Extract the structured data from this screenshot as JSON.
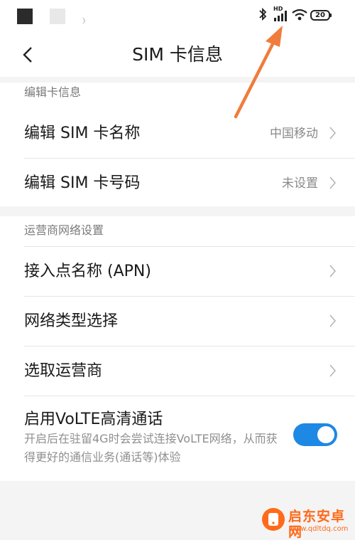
{
  "status_bar": {
    "signal_badge": "HD",
    "battery_level": "20",
    "icons": [
      "bluetooth-icon",
      "signal-icon",
      "wifi-icon",
      "battery-icon"
    ]
  },
  "header": {
    "title": "SIM  卡信息",
    "back_icon": "chevron-left-icon"
  },
  "sections": {
    "edit_card": {
      "title": "编辑卡信息",
      "items": [
        {
          "label": "编辑 SIM 卡名称",
          "value": "中国移动"
        },
        {
          "label": "编辑 SIM 卡号码",
          "value": "未设置"
        }
      ]
    },
    "carrier_network": {
      "title": "运营商网络设置",
      "items": [
        {
          "label": "接入点名称 (APN)"
        },
        {
          "label": "网络类型选择"
        },
        {
          "label": "选取运营商"
        }
      ],
      "volte": {
        "label": "启用VoLTE高清通话",
        "description": "开启后在驻留4G时会尝试连接VoLTE网络，从而获得更好的通信业务(通话等)体验",
        "enabled": true
      }
    }
  },
  "watermark": {
    "name": "启东安卓网",
    "url": "www.qdltdq.com"
  },
  "colors": {
    "accent": "#1e88e5",
    "annotation_arrow": "#f07c3c",
    "watermark": "#ff6a1a"
  }
}
